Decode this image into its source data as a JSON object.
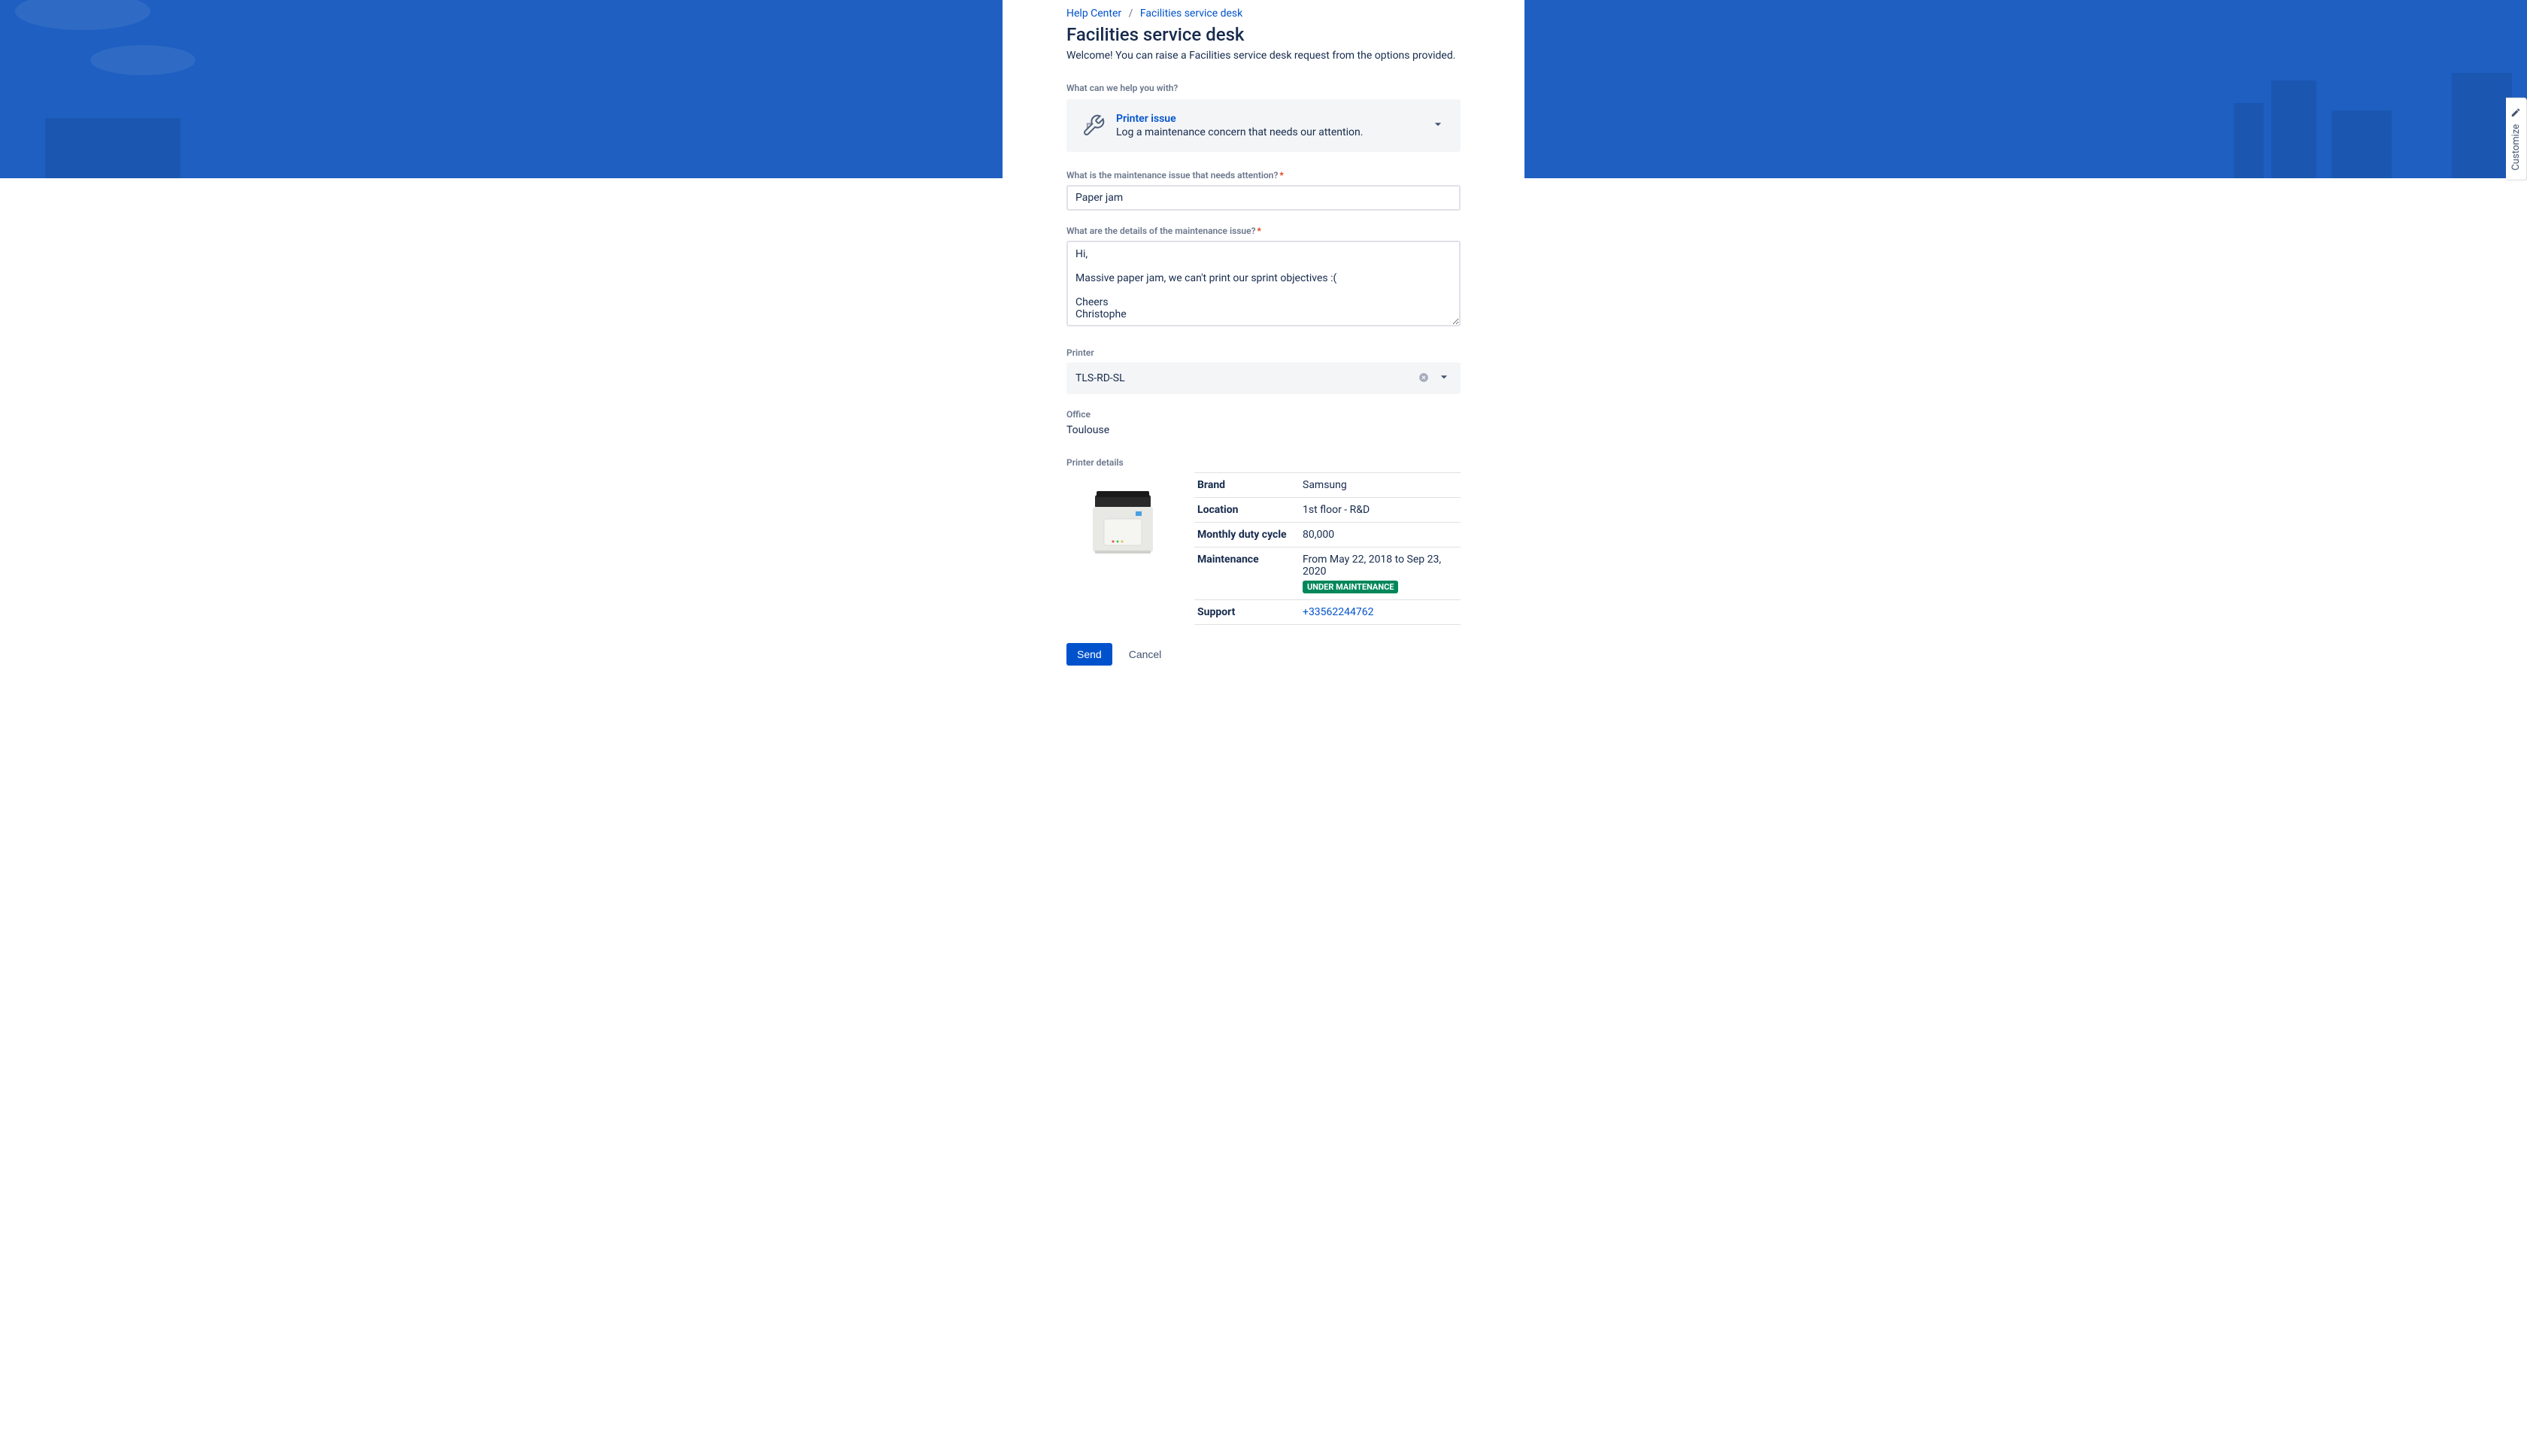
{
  "breadcrumb": {
    "help_center": "Help Center",
    "service_desk": "Facilities service desk"
  },
  "page": {
    "title": "Facilities service desk",
    "welcome": "Welcome! You can raise a Facilities service desk request from the options provided."
  },
  "help_section": {
    "label": "What can we help you with?",
    "request_type_title": "Printer issue",
    "request_type_desc": "Log a maintenance concern that needs our attention."
  },
  "fields": {
    "issue_summary_label": "What is the maintenance issue that needs attention?",
    "issue_summary_value": "Paper jam",
    "details_label": "What are the details of the maintenance issue?",
    "details_value": "Hi,\n\nMassive paper jam, we can't print our sprint objectives :(\n\nCheers\nChristophe",
    "printer_label": "Printer",
    "printer_value": "TLS-RD-SL",
    "office_label": "Office",
    "office_value": "Toulouse"
  },
  "printer_details": {
    "section_label": "Printer details",
    "rows": {
      "brand_label": "Brand",
      "brand_value": "Samsung",
      "location_label": "Location",
      "location_value": "1st floor - R&D",
      "duty_label": "Monthly duty cycle",
      "duty_value": "80,000",
      "maintenance_label": "Maintenance",
      "maintenance_value": "From May 22, 2018 to Sep 23, 2020",
      "maintenance_badge": "UNDER MAINTENANCE",
      "support_label": "Support",
      "support_value": "+33562244762"
    }
  },
  "actions": {
    "send": "Send",
    "cancel": "Cancel"
  },
  "customize_tab": "Customize"
}
